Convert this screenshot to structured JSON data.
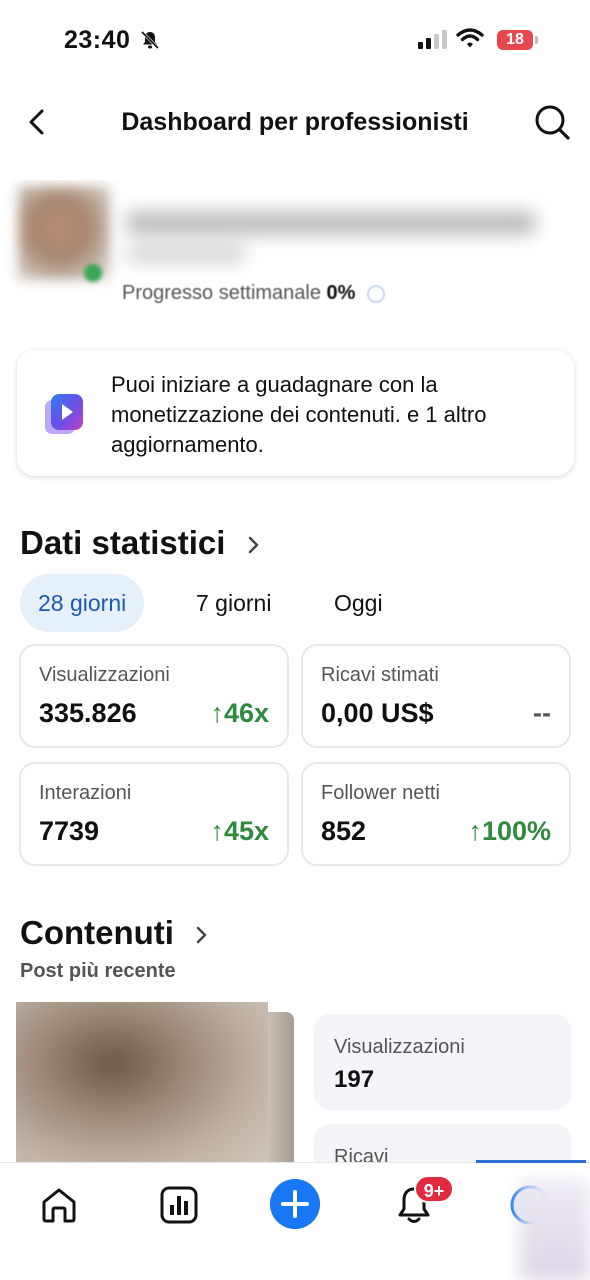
{
  "status_bar": {
    "time": "23:40",
    "battery": "18"
  },
  "header": {
    "title": "Dashboard per professionisti"
  },
  "profile": {
    "weekly_progress_label": "Progresso settimanale",
    "weekly_progress_value": "0%"
  },
  "notice": {
    "text": "Puoi iniziare a guadagnare con la monetizzazione dei contenuti. e 1 altro aggiornamento."
  },
  "stats": {
    "title": "Dati statistici",
    "tabs": [
      "28 giorni",
      "7 giorni",
      "Oggi"
    ],
    "cards": [
      {
        "label": "Visualizzazioni",
        "value": "335.826",
        "change": "↑46x"
      },
      {
        "label": "Ricavi stimati",
        "value": "0,00 US$",
        "change": "--"
      },
      {
        "label": "Interazioni",
        "value": "7739",
        "change": "↑45x"
      },
      {
        "label": "Follower netti",
        "value": "852",
        "change": "↑100%"
      }
    ]
  },
  "contents": {
    "title": "Contenuti",
    "subtitle": "Post più recente",
    "metrics": [
      {
        "label": "Visualizzazioni",
        "value": "197"
      },
      {
        "label": "Ricavi"
      }
    ]
  },
  "bottom_nav": {
    "notifications_badge": "9+"
  },
  "colors": {
    "accent": "#1877f2",
    "positive": "#2f8a3e",
    "badge": "#e02b3e",
    "active_tab_bg": "#e6f0fb"
  }
}
